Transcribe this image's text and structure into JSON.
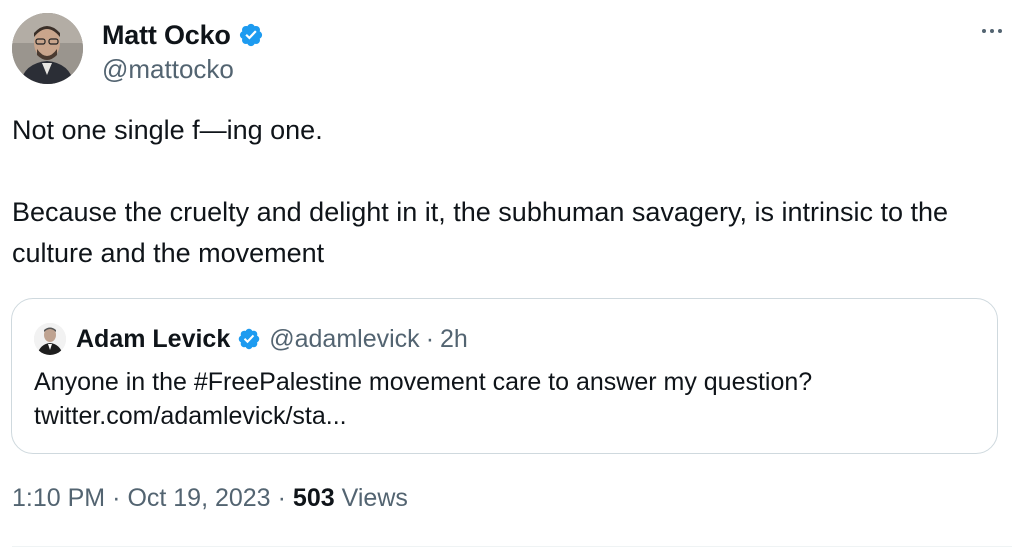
{
  "author": {
    "display_name": "Matt Ocko",
    "handle": "@mattocko",
    "verified": true
  },
  "tweet": {
    "paragraphs": [
      "Not one single f—ing one.",
      "Because the cruelty and delight in it, the subhuman savagery, is intrinsic to the culture and the movement"
    ]
  },
  "quoted_tweet": {
    "display_name": "Adam Levick",
    "handle": "@adamlevick",
    "separator": "·",
    "time": "2h",
    "verified": true,
    "text_line1": "Anyone in the #FreePalestine movement care to answer my question?",
    "text_line2": "twitter.com/adamlevick/sta..."
  },
  "meta": {
    "time": "1:10 PM",
    "separator": "·",
    "date": "Oct 19, 2023",
    "views_count": "503",
    "views_label": "Views"
  },
  "colors": {
    "verified_blue": "#1d9bf0",
    "secondary_text": "#536471",
    "primary_text": "#0f1419",
    "border": "#cfd9de"
  },
  "icons": {
    "verified": "verified-badge-icon",
    "more": "more-horizontal-icon"
  }
}
